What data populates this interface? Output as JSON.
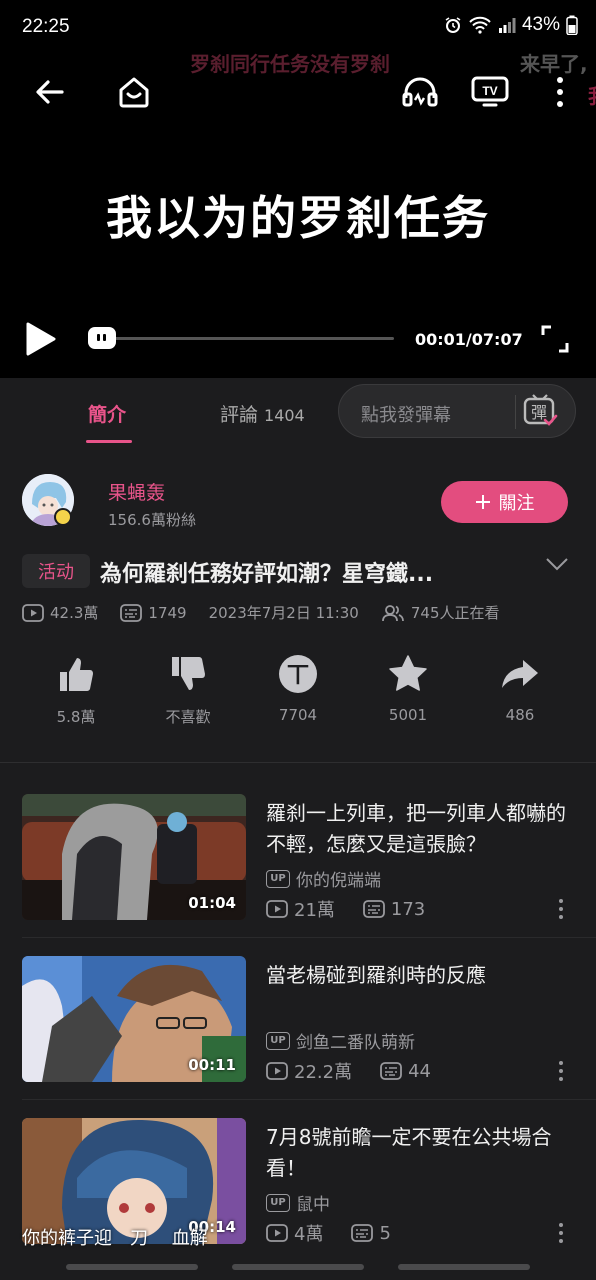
{
  "status_bar": {
    "time": "22:25",
    "battery": "43%"
  },
  "player": {
    "danmaku": [
      "罗刹同行任务没有罗刹",
      "来早了,",
      "我"
    ],
    "video_title": "我以为的罗刹任务",
    "time": "00:01/07:07",
    "progress_fraction": 0.002
  },
  "tabs": {
    "intro": "簡介",
    "comments": "評論",
    "comments_count": "1404",
    "danmaku_placeholder": "點我發彈幕",
    "danmaku_icon_char": "彈"
  },
  "uploader": {
    "name": "果蝇轰",
    "fans": "156.6萬粉絲",
    "follow_label": "關注"
  },
  "video": {
    "tag": "活动",
    "title": "為何羅刹任務好評如潮？星穹鐵...",
    "views": "42.3萬",
    "danmaku_count": "1749",
    "date": "2023年7月2日 11:30",
    "watching": "745人正在看"
  },
  "actions": {
    "like": "5.8萬",
    "dislike": "不喜歡",
    "coin": "7704",
    "favorite": "5001",
    "share": "486",
    "coin_char": "丅"
  },
  "recommendations": [
    {
      "title": "羅刹一上列車，把一列車人都嚇的不輕，怎麼又是這張臉？",
      "uploader": "你的倪端端",
      "duration": "01:04",
      "views": "21萬",
      "danmaku": "173"
    },
    {
      "title": "當老楊碰到羅刹時的反應",
      "uploader": "剑鱼二番队萌新",
      "duration": "00:11",
      "views": "22.2萬",
      "danmaku": "44"
    },
    {
      "title": "7月8號前瞻一定不要在公共場合看！",
      "uploader": "鼠中",
      "duration": "00:14",
      "views": "4萬",
      "danmaku": "5"
    }
  ],
  "up_tag_label": "UP",
  "subtitle_overlay": "你的裤子迎　刀　 血解",
  "colors": {
    "accent": "#e8548a",
    "follow_button": "#e34d7f",
    "background": "#1c1c1e"
  }
}
